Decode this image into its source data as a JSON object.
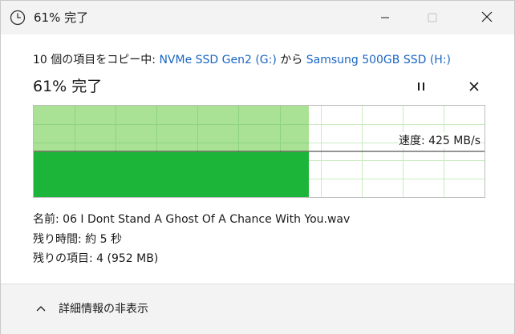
{
  "window": {
    "title": "61% 完了",
    "icons": {
      "app": "clock-icon",
      "minimize": "minimize-icon",
      "maximize": "maximize-icon",
      "close": "close-icon"
    }
  },
  "copy": {
    "prefix": "10 個の項目をコピー中: ",
    "source": "NVMe SSD Gen2 (G:)",
    "middle": " から ",
    "destination": "Samsung 500GB SSD (H:)"
  },
  "progress": {
    "title": "61% 完了",
    "percent": 61,
    "pause_icon": "pause-icon",
    "cancel_icon": "cancel-icon"
  },
  "speed": {
    "label": "速度: 425 MB/s"
  },
  "details": {
    "name": "名前: 06 I Dont Stand A Ghost Of A Chance With You.wav",
    "time_remaining": "残り時間: 約 5 秒",
    "items_remaining": "残りの項目: 4 (952 MB)"
  },
  "footer": {
    "toggle_label": "詳細情報の非表示",
    "toggle_icon": "chevron-up-icon"
  },
  "colors": {
    "accent_link": "#1a66c4",
    "progress_fill": "#a9e295",
    "speed_fill": "#1cb53a",
    "grid_line": "#8fd27e"
  }
}
